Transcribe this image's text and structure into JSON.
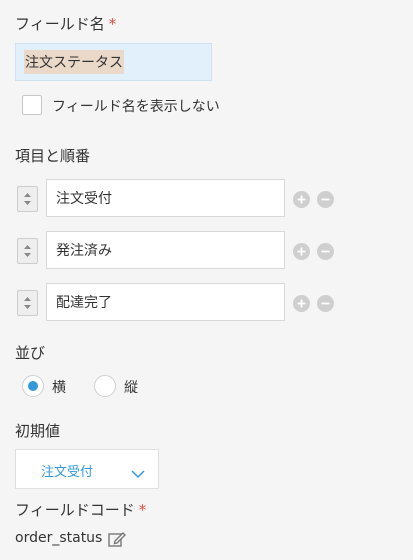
{
  "field_name": {
    "label": "フィールド名",
    "required_mark": "*",
    "value": "注文ステータス"
  },
  "hide_name": {
    "label": "フィールド名を表示しない",
    "checked": false
  },
  "items_section": {
    "label": "項目と順番",
    "items": [
      {
        "value": "注文受付"
      },
      {
        "value": "発注済み"
      },
      {
        "value": "配達完了"
      }
    ]
  },
  "alignment": {
    "label": "並び",
    "options": [
      {
        "label": "横",
        "selected": true
      },
      {
        "label": "縦",
        "selected": false
      }
    ]
  },
  "default_value": {
    "label": "初期値",
    "selected": "注文受付"
  },
  "field_code": {
    "label": "フィールドコード",
    "required_mark": "*",
    "value": "order_status"
  },
  "icons": {
    "drag": "drag-handle-icon",
    "add": "plus-circle-icon",
    "remove": "minus-circle-icon",
    "dropdown": "chevron-down-icon",
    "edit": "edit-icon"
  },
  "colors": {
    "accent": "#3498db",
    "required": "#e74c3c",
    "name_input_bg": "#e1f0fb"
  }
}
